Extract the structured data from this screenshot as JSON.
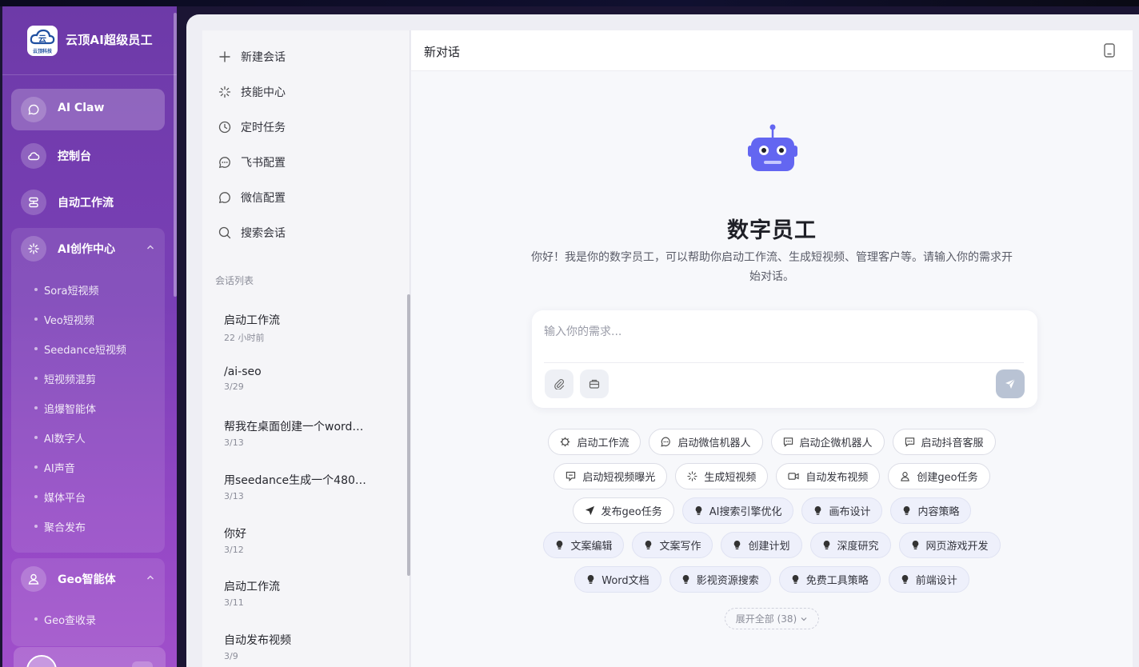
{
  "brand": {
    "name": "云顶AI超级员工",
    "logo_text": "云顶科技"
  },
  "sidebar": {
    "items": [
      {
        "label": "AI Claw",
        "icon": "chat-bubble-icon",
        "active": true
      },
      {
        "label": "控制台",
        "icon": "cloud-icon"
      },
      {
        "label": "自动工作流",
        "icon": "workflow-icon"
      },
      {
        "label": "AI创作中心",
        "icon": "sparkle-icon",
        "expanded": true
      },
      {
        "label": "Geo智能体",
        "icon": "person-icon",
        "expanded": true
      }
    ],
    "ai_creation_sub": [
      "Sora短视频",
      "Veo短视频",
      "Seedance短视频",
      "短视频混剪",
      "追爆智能体",
      "AI数字人",
      "AI声音",
      "媒体平台",
      "聚合发布"
    ],
    "geo_sub": [
      "Geo查收录"
    ]
  },
  "conv_menu": [
    {
      "label": "新建会话",
      "icon": "plus-icon"
    },
    {
      "label": "技能中心",
      "icon": "sparkle-icon"
    },
    {
      "label": "定时任务",
      "icon": "clock-icon"
    },
    {
      "label": "飞书配置",
      "icon": "chat-dots-icon"
    },
    {
      "label": "微信配置",
      "icon": "chat-bubble-icon"
    },
    {
      "label": "搜索会话",
      "icon": "search-icon"
    }
  ],
  "conv_list_title": "会话列表",
  "conversations": [
    {
      "title": "启动工作流",
      "time": "22 小时前"
    },
    {
      "title": "/ai-seo",
      "time": "3/29"
    },
    {
      "title": "帮我在桌面创建一个word…",
      "time": "3/13"
    },
    {
      "title": "用seedance生成一个480…",
      "time": "3/13"
    },
    {
      "title": "你好",
      "time": "3/12"
    },
    {
      "title": "启动工作流",
      "time": "3/11"
    },
    {
      "title": "自动发布视频",
      "time": "3/9"
    }
  ],
  "chat": {
    "title": "新对话",
    "hero_title": "数字员工",
    "hero_desc": "你好！我是你的数字员工，可以帮助你启动工作流、生成短视频、管理客户等。请输入你的需求开始对话。",
    "input_placeholder": "输入你的需求..."
  },
  "chips": [
    [
      {
        "label": "启动工作流",
        "icon": "gear-icon"
      },
      {
        "label": "启动微信机器人",
        "icon": "chat-dots-icon"
      },
      {
        "label": "启动企微机器人",
        "icon": "message-square-icon"
      },
      {
        "label": "启动抖音客服",
        "icon": "message-square-icon"
      }
    ],
    [
      {
        "label": "启动短视频曝光",
        "icon": "screen-chat-icon"
      },
      {
        "label": "生成短视频",
        "icon": "sparkle-icon"
      },
      {
        "label": "自动发布视频",
        "icon": "video-icon"
      },
      {
        "label": "创建geo任务",
        "icon": "person-icon"
      }
    ],
    [
      {
        "label": "发布geo任务",
        "icon": "send-icon"
      },
      {
        "label": "AI搜索引擎优化",
        "icon": "bulb-icon",
        "tinted": true
      },
      {
        "label": "画布设计",
        "icon": "bulb-icon",
        "tinted": true
      },
      {
        "label": "内容策略",
        "icon": "bulb-icon",
        "tinted": true
      }
    ],
    [
      {
        "label": "文案编辑",
        "icon": "bulb-icon",
        "tinted": true
      },
      {
        "label": "文案写作",
        "icon": "bulb-icon",
        "tinted": true
      },
      {
        "label": "创建计划",
        "icon": "bulb-icon",
        "tinted": true
      },
      {
        "label": "深度研究",
        "icon": "bulb-icon",
        "tinted": true
      },
      {
        "label": "网页游戏开发",
        "icon": "bulb-icon",
        "tinted": true
      }
    ],
    [
      {
        "label": "Word文档",
        "icon": "bulb-icon",
        "tinted": true
      },
      {
        "label": "影视资源搜索",
        "icon": "bulb-icon",
        "tinted": true
      },
      {
        "label": "免费工具策略",
        "icon": "bulb-icon",
        "tinted": true
      },
      {
        "label": "前端设计",
        "icon": "bulb-icon",
        "tinted": true
      }
    ]
  ],
  "expand_label": "展开全部 (38)",
  "colors": {
    "accent_purple": "#7a3fb6",
    "robot": "#6366f1"
  }
}
